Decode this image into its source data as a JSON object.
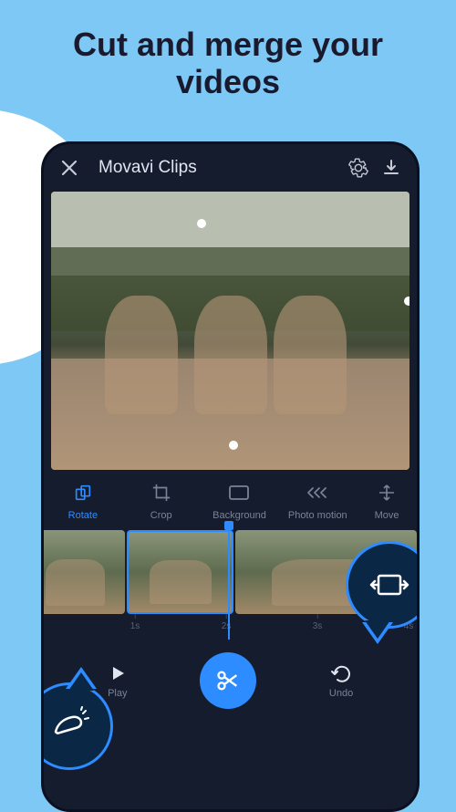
{
  "headline": "Cut and merge your videos",
  "header": {
    "title": "Movavi Clips"
  },
  "tools": [
    {
      "id": "rotate",
      "label": "Rotate",
      "active": true
    },
    {
      "id": "crop",
      "label": "Crop",
      "active": false
    },
    {
      "id": "background",
      "label": "Background",
      "active": false
    },
    {
      "id": "photo-motion",
      "label": "Photo motion",
      "active": false
    },
    {
      "id": "move",
      "label": "Move",
      "active": false
    }
  ],
  "ruler": {
    "ticks": [
      "1s",
      "2s",
      "3s",
      "4s"
    ]
  },
  "controls": {
    "play": "Play",
    "undo": "Undo"
  }
}
